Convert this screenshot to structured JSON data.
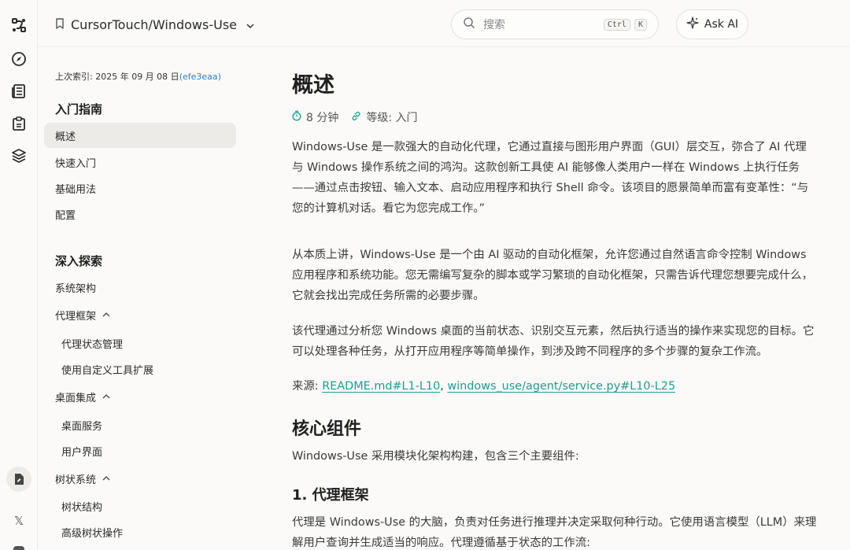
{
  "rail": {
    "icons": [
      "workflow-icon",
      "compass-icon",
      "newspaper-icon",
      "clipboard-icon",
      "layers-icon",
      "file-edit-icon",
      "x-logo-icon",
      "discord-icon"
    ]
  },
  "topbar": {
    "repo_name": "CursorTouch/Windows-Use",
    "search_placeholder": "搜索",
    "shortcut_ctrl": "Ctrl",
    "shortcut_k": "K",
    "ask_ai_label": "Ask AI"
  },
  "sidebar": {
    "indexed_label": "上次索引: 2025 年 09 月 08 日",
    "indexed_hash": "(efe3eaa)",
    "section1_title": "入门指南",
    "section1_items": [
      "概述",
      "快速入门",
      "基础用法",
      "配置"
    ],
    "section2_title": "深入探索",
    "section2_items": {
      "arch": "系统架构",
      "agent_framework": "代理框架",
      "agent_state": "代理状态管理",
      "custom_tools": "使用自定义工具扩展",
      "desktop_integration": "桌面集成",
      "desktop_service": "桌面服务",
      "ui": "用户界面",
      "tree_system": "树状系统",
      "tree_structure": "树状结构",
      "advanced_tree": "高级树状操作"
    }
  },
  "content": {
    "title": "概述",
    "read_time": "8 分钟",
    "level": "等级: 入门",
    "p1": "Windows-Use 是一款强大的自动化代理，它通过直接与图形用户界面（GUI）层交互，弥合了 AI 代理与 Windows 操作系统之间的鸿沟。这款创新工具使 AI 能够像人类用户一样在 Windows 上执行任务——通过点击按钮、输入文本、启动应用程序和执行 Shell 命令。该项目的愿景简单而富有变革性：“与您的计算机对话。看它为您完成工作。”",
    "p2": "从本质上讲，Windows-Use 是一个由 AI 驱动的自动化框架，允许您通过自然语言命令控制 Windows 应用程序和系统功能。您无需编写复杂的脚本或学习繁琐的自动化框架，只需告诉代理您想要完成什么，它就会找出完成任务所需的必要步骤。",
    "p3": "该代理通过分析您 Windows 桌面的当前状态、识别交互元素，然后执行适当的操作来实现您的目标。它可以处理各种任务，从打开应用程序等简单操作，到涉及跨不同程序的多个步骤的复杂工作流。",
    "source_label": "来源:",
    "source_link1": "README.md#L1-L10",
    "source_sep": ",",
    "source_link2": "windows_use/agent/service.py#L10-L25",
    "h2_core": "核心组件",
    "p4": "Windows-Use 采用模块化架构构建，包含三个主要组件:",
    "h3_agent": "1. 代理框架",
    "p5": "代理是 Windows-Use 的大脑，负责对任务进行推理并决定采取何种行动。它使用语言模型（LLM）来理解用户查询并生成适当的响应。代理遵循基于状态的工作流:"
  },
  "colors": {
    "accent_link": "#1e9c8f",
    "hash_link": "#2f7fc1",
    "active_bg": "#ecebe8",
    "page_bg": "#fbfaf8"
  }
}
